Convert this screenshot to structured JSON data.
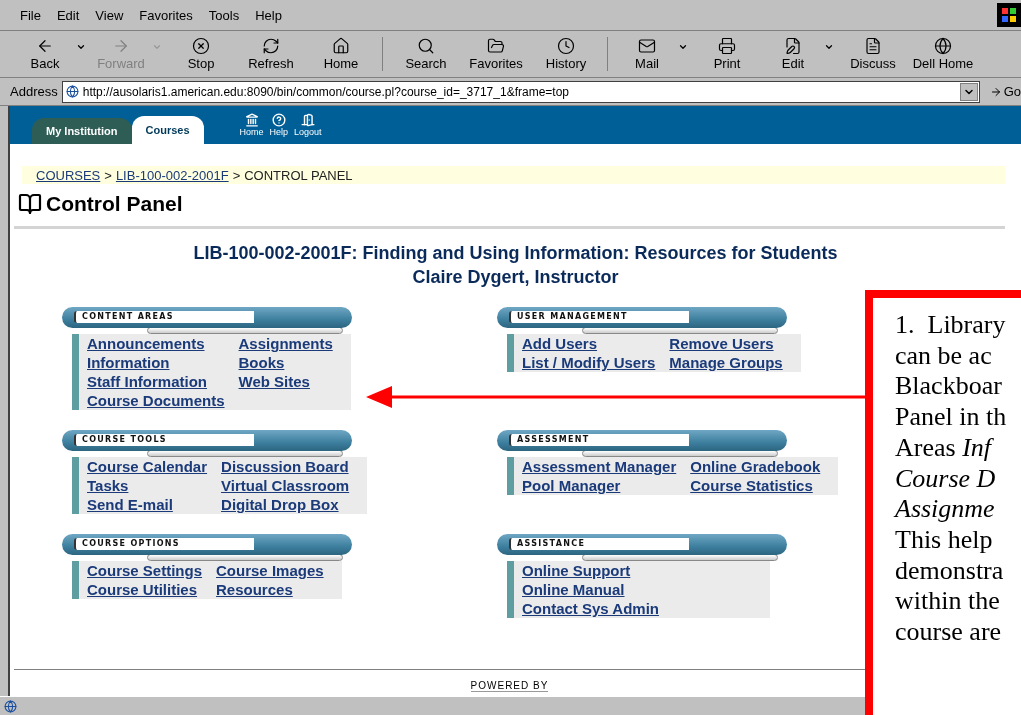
{
  "menu": [
    "File",
    "Edit",
    "View",
    "Favorites",
    "Tools",
    "Help"
  ],
  "toolbar": {
    "groups": [
      [
        {
          "label": "Back",
          "disabled": false,
          "dropdown": true
        },
        {
          "label": "Forward",
          "disabled": true,
          "dropdown": true
        },
        {
          "label": "Stop",
          "disabled": false,
          "dropdown": false
        },
        {
          "label": "Refresh",
          "disabled": false,
          "dropdown": false
        },
        {
          "label": "Home",
          "disabled": false,
          "dropdown": false
        }
      ],
      [
        {
          "label": "Search",
          "disabled": false,
          "dropdown": false
        },
        {
          "label": "Favorites",
          "disabled": false,
          "dropdown": false
        },
        {
          "label": "History",
          "disabled": false,
          "dropdown": false
        }
      ],
      [
        {
          "label": "Mail",
          "disabled": false,
          "dropdown": true
        },
        {
          "label": "Print",
          "disabled": false,
          "dropdown": false
        },
        {
          "label": "Edit",
          "disabled": false,
          "dropdown": true
        },
        {
          "label": "Discuss",
          "disabled": false,
          "dropdown": false
        },
        {
          "label": "Dell Home",
          "disabled": false,
          "dropdown": false
        }
      ]
    ]
  },
  "address_bar": {
    "label": "Address",
    "value": "http://ausolaris1.american.edu:8090/bin/common/course.pl?course_id=_3717_1&frame=top",
    "go": "Go"
  },
  "tabs": [
    {
      "label": "My Institution",
      "selected": false
    },
    {
      "label": "Courses",
      "selected": true
    }
  ],
  "nav_icons": [
    "Home",
    "Help",
    "Logout"
  ],
  "breadcrumb": [
    {
      "text": "COURSES",
      "link": true
    },
    {
      "text": ">",
      "link": false
    },
    {
      "text": "LIB-100-002-2001F",
      "link": true
    },
    {
      "text": ">",
      "link": false
    },
    {
      "text": "CONTROL PANEL",
      "link": false
    }
  ],
  "page_title": "Control Panel",
  "course_title": "LIB-100-002-2001F:  Finding and Using Information: Resources for Students",
  "instructor": "Claire Dygert, Instructor",
  "sections": [
    {
      "title": "CONTENT AREAS",
      "columns": [
        [
          "Announcements",
          "Information",
          "Staff Information",
          "Course Documents"
        ],
        [
          "Assignments",
          "Books",
          "Web Sites"
        ]
      ]
    },
    {
      "title": "USER MANAGEMENT",
      "columns": [
        [
          "Add Users",
          "List / Modify Users"
        ],
        [
          "Remove Users",
          "Manage Groups"
        ]
      ]
    },
    {
      "title": "COURSE TOOLS",
      "columns": [
        [
          "Course Calendar",
          "Tasks",
          "Send E-mail"
        ],
        [
          "Discussion Board",
          "Virtual Classroom",
          "Digital Drop Box"
        ]
      ]
    },
    {
      "title": "ASSESSMENT",
      "columns": [
        [
          "Assessment Manager",
          "Pool Manager"
        ],
        [
          "Online Gradebook",
          "Course Statistics"
        ]
      ]
    },
    {
      "title": "COURSE OPTIONS",
      "columns": [
        [
          "Course Settings",
          "Course Utilities"
        ],
        [
          "Course Images",
          "Resources"
        ]
      ]
    },
    {
      "title": "ASSISTANCE",
      "columns": [
        [
          "Online Support",
          "Online Manual",
          "Contact Sys Admin"
        ]
      ]
    }
  ],
  "footer": "POWERED BY",
  "callout": {
    "lines": [
      "1.  Library",
      "can be ac",
      "Blackboar",
      "Panel in th",
      "Areas *Inf*",
      "*Course D*",
      "*Assignme*",
      "This help",
      "demonstra",
      "within the",
      "course are"
    ]
  }
}
